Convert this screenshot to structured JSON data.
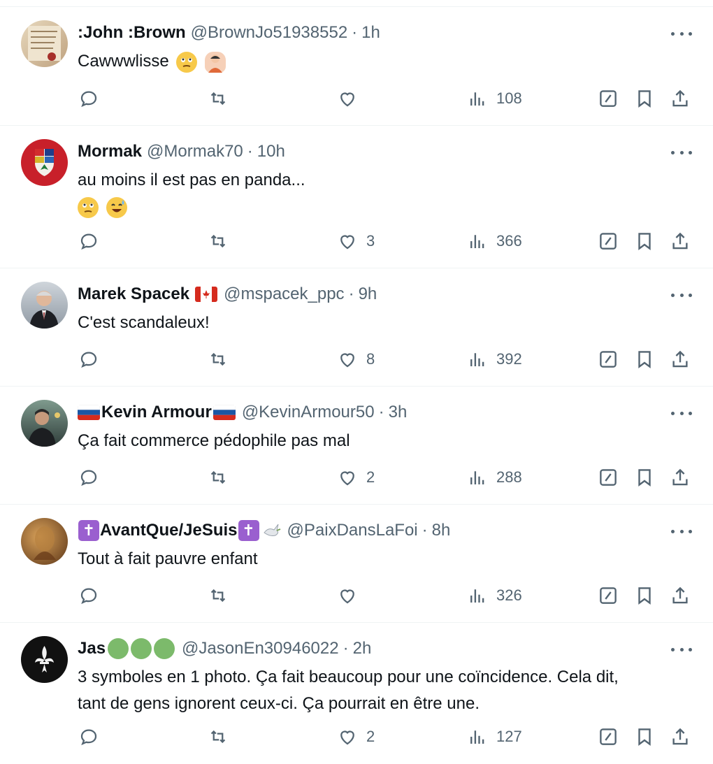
{
  "replies": [
    {
      "name": ":John :Brown",
      "handle": "@BrownJo51938552",
      "sep": "·",
      "time": "1h",
      "text": "Cawwwlisse",
      "replies_count": "",
      "retweets_count": "",
      "likes": "",
      "views": "108",
      "avatar_color": "#d9c7a8"
    },
    {
      "name": "Mormak",
      "handle": "@Mormak70",
      "sep": "·",
      "time": "10h",
      "text": "au moins il est pas en panda...",
      "likes": "3",
      "views": "366",
      "avatar_color": "#c8202a"
    },
    {
      "name": "Marek Spacek",
      "handle": "@mspacek_ppc",
      "sep": "·",
      "time": "9h",
      "text": "C'est scandaleux!",
      "likes": "8",
      "views": "392",
      "avatar_color": "#9aa3ad"
    },
    {
      "name": "Kevin Armour",
      "handle": "@KevinArmour50",
      "sep": "·",
      "time": "3h",
      "text": "Ça fait commerce pédophile pas mal",
      "likes": "2",
      "views": "288",
      "avatar_color": "#5a6b63"
    },
    {
      "name": "AvantQue/JeSuis",
      "cross": "✝",
      "handle": "@PaixDansLaFoi",
      "sep": "·",
      "time": "8h",
      "text": "Tout à fait pauvre enfant",
      "likes": "",
      "views": "326",
      "avatar_color": "#8a5a2e"
    },
    {
      "name": "Jas",
      "handle": "@JasonEn30946022",
      "sep": "·",
      "time": "2h",
      "text_line1": "3 symboles en 1 photo.  Ça fait beaucoup pour une coïncidence.  Cela dit,",
      "text_line2": "tant de gens ignorent ceux-ci.  Ça pourrait en être une.",
      "likes": "2",
      "views": "127",
      "avatar_color": "#111111",
      "avatar_glyph": "⚜"
    }
  ],
  "colors": {
    "text": "#0f1419",
    "muted": "#536471",
    "divider": "#eff3f4"
  },
  "icons": [
    "reply-icon",
    "retweet-icon",
    "like-icon",
    "views-icon",
    "grok-icon",
    "bookmark-icon",
    "share-icon",
    "more-icon"
  ]
}
